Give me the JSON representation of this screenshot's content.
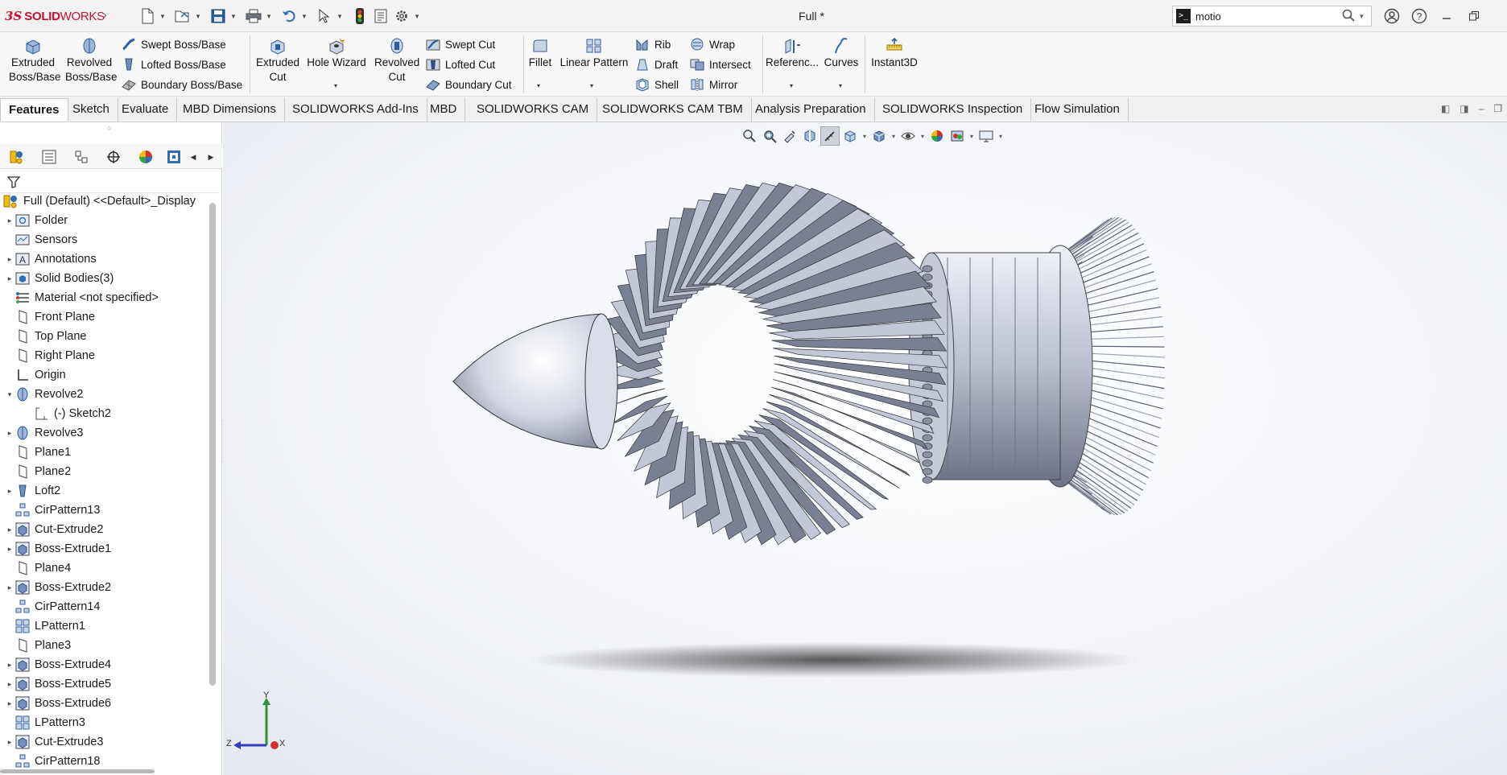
{
  "app": {
    "logo_ds": "3S",
    "logo_solid": "SOLID",
    "logo_works": "WORKS",
    "document_title": "Full *"
  },
  "search": {
    "query": "motio"
  },
  "ribbon": {
    "extruded_boss": "Extruded Boss/Base",
    "revolved_boss": "Revolved Boss/Base",
    "swept_boss": "Swept Boss/Base",
    "lofted_boss": "Lofted Boss/Base",
    "boundary_boss": "Boundary Boss/Base",
    "extruded_cut": "Extruded Cut",
    "hole_wizard": "Hole Wizard",
    "revolved_cut": "Revolved Cut",
    "swept_cut": "Swept Cut",
    "lofted_cut": "Lofted Cut",
    "boundary_cut": "Boundary Cut",
    "fillet": "Fillet",
    "linear_pattern": "Linear Pattern",
    "rib": "Rib",
    "draft": "Draft",
    "shell": "Shell",
    "wrap": "Wrap",
    "intersect": "Intersect",
    "mirror": "Mirror",
    "reference": "Referenc...",
    "curves": "Curves",
    "instant3d": "Instant3D"
  },
  "tabs": [
    "Features",
    "Sketch",
    "Evaluate",
    "MBD Dimensions",
    "SOLIDWORKS Add-Ins",
    "MBD",
    "SOLIDWORKS CAM",
    "SOLIDWORKS CAM TBM",
    "Analysis Preparation",
    "SOLIDWORKS Inspection",
    "Flow Simulation"
  ],
  "tree": {
    "root": "Full (Default) <<Default>_Display",
    "items": [
      "Folder",
      "Sensors",
      "Annotations",
      "Solid Bodies(3)",
      "Material <not specified>",
      "Front Plane",
      "Top Plane",
      "Right Plane",
      "Origin",
      "Revolve2",
      "(-) Sketch2",
      "Revolve3",
      "Plane1",
      "Plane2",
      "Loft2",
      "CirPattern13",
      "Cut-Extrude2",
      "Boss-Extrude1",
      "Plane4",
      "Boss-Extrude2",
      "CirPattern14",
      "LPattern1",
      "Plane3",
      "Boss-Extrude4",
      "Boss-Extrude5",
      "Boss-Extrude6",
      "LPattern3",
      "Cut-Extrude3",
      "CirPattern18"
    ]
  },
  "triad": {
    "y": "Y",
    "z": "Z",
    "x": "X"
  },
  "colors": {
    "brand": "#c8102e",
    "accent": "#2f6db5",
    "model_steel": "#aab0c4"
  }
}
